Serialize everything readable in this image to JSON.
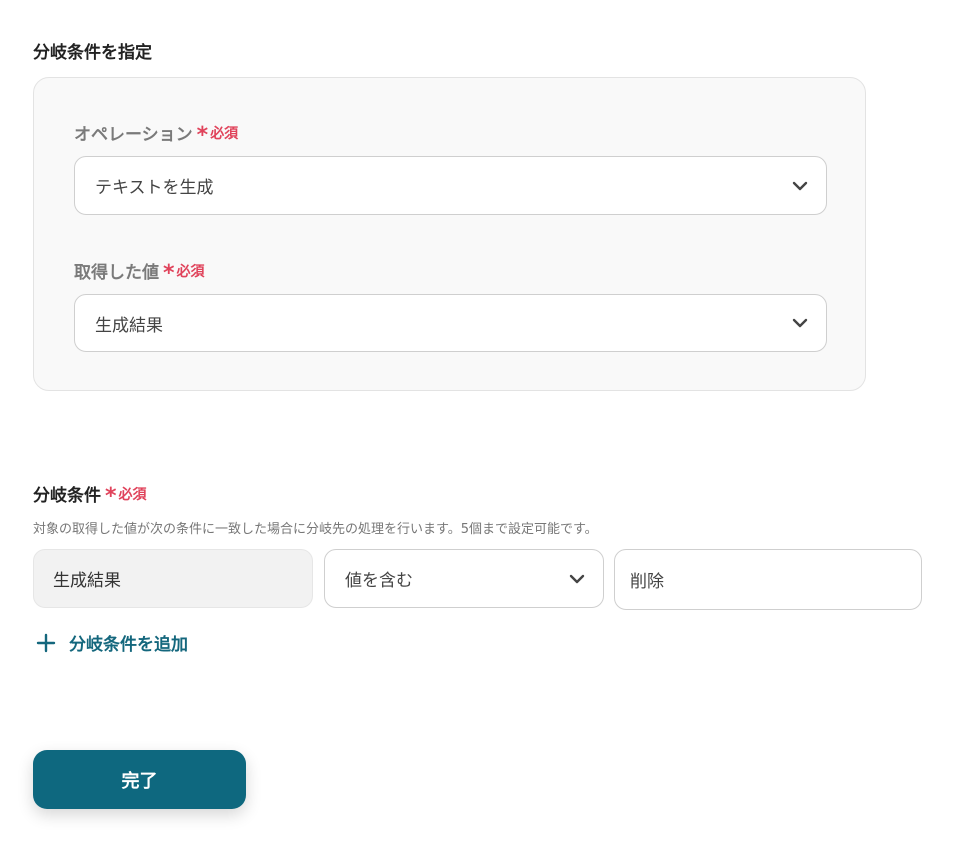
{
  "section_title": "分岐条件を指定",
  "required_label": "必須",
  "required_star": "*",
  "operation": {
    "label": "オペレーション",
    "value": "テキストを生成"
  },
  "acquired_value": {
    "label": "取得した値",
    "value": "生成結果"
  },
  "branch_condition": {
    "label": "分岐条件",
    "help": "対象の取得した値が次の条件に一致した場合に分岐先の処理を行います。5個まで設定可能です。",
    "target": "生成結果",
    "operator": "値を含む",
    "value": "削除"
  },
  "add_condition_label": "分岐条件を追加",
  "done_label": "完了",
  "colors": {
    "accent": "#0e687f",
    "required": "#e0435b",
    "link": "#14677d"
  },
  "icons": {
    "chevron": "chevron-down-icon",
    "plus": "plus-icon"
  }
}
